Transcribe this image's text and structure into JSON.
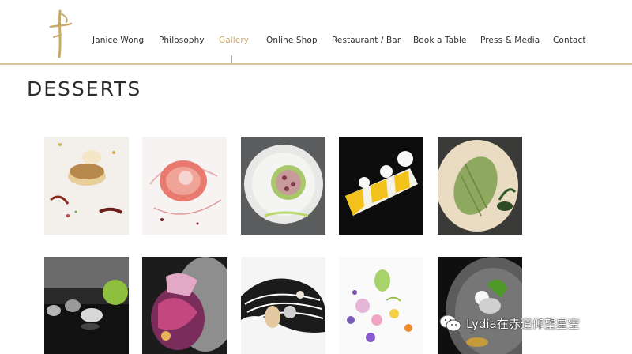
{
  "nav": {
    "items": [
      {
        "label": "Janice Wong"
      },
      {
        "label": "Philosophy"
      },
      {
        "label": "Gallery"
      },
      {
        "label": "Online Shop"
      },
      {
        "label": "Restaurant / Bar"
      },
      {
        "label": "Book a Table"
      },
      {
        "label": "Press & Media"
      },
      {
        "label": "Contact"
      }
    ],
    "active": "Gallery"
  },
  "page": {
    "title": "DESSERTS"
  },
  "watermark": {
    "text": "Lydia在赤道仰望星空",
    "icon": "wechat-icon"
  },
  "colors": {
    "accent": "#c9a86a",
    "divider": "#d9c39a",
    "text": "#2e2e2e"
  }
}
